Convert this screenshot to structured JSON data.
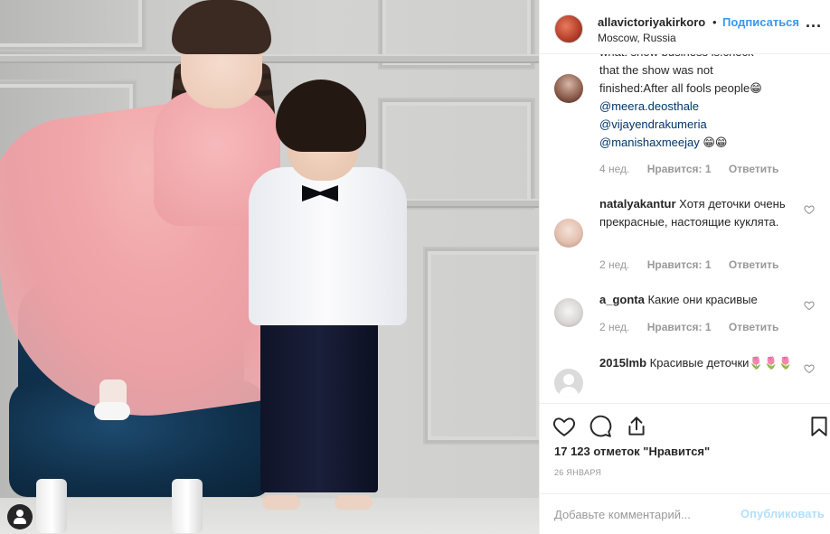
{
  "post": {
    "header": {
      "username": "allavictoriyakirkoro",
      "separator": "•",
      "follow_label": "Подписаться",
      "location": "Moscow, Russia",
      "more_label": "..."
    },
    "comments": [
      {
        "partial_line": "what: show business is.check",
        "lines": [
          "that the show was not",
          "finished:After all fools people😁"
        ],
        "mentions": [
          "@meera.deosthale",
          "@vijayendrakumeria"
        ],
        "last_mention": "@manishaxmeejay",
        "emoji": "😁😁",
        "time": "4 нед.",
        "likes": "Нравится: 1",
        "reply": "Ответить"
      },
      {
        "username": "natalyakantur",
        "text": "Хотя деточки очень прекрасные, настоящие куклята.",
        "time": "2 нед.",
        "likes": "Нравится: 1",
        "reply": "Ответить"
      },
      {
        "username": "a_gonta",
        "text": "Какие они красивые",
        "time": "2 нед.",
        "likes": "Нравится: 1",
        "reply": "Ответить"
      },
      {
        "username": "2015lmb",
        "text": "Красивые деточки🌷🌷🌷"
      }
    ],
    "like_count": "17 123 отметок \"Нравится\"",
    "date": "26 ЯНВАРЯ",
    "add_comment_placeholder": "Добавьте комментарий...",
    "post_button": "Опубликовать"
  },
  "colors": {
    "link_blue": "#3897f0",
    "mention_blue": "#003569",
    "disabled_blue": "#b2dffc",
    "meta_gray": "#999999"
  }
}
